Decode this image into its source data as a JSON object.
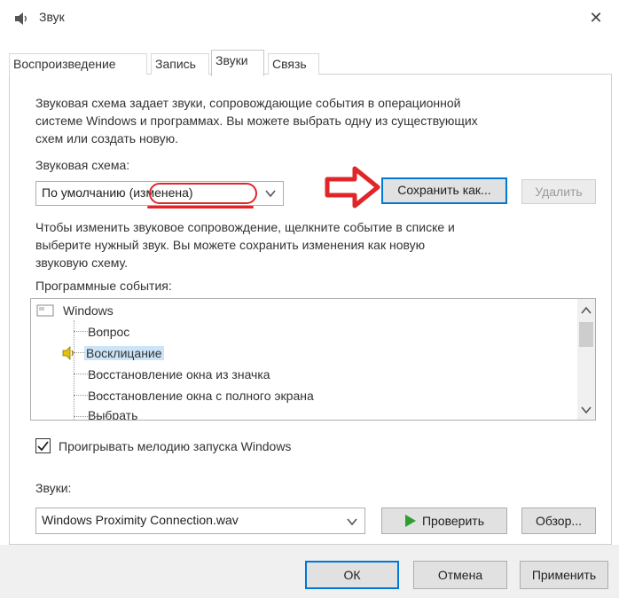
{
  "window": {
    "title": "Звук",
    "accent_color": "#0078d7",
    "highlight_color": "#e1262a"
  },
  "tabs": [
    {
      "label": "Воспроизведение",
      "active": false
    },
    {
      "label": "Запись",
      "active": false
    },
    {
      "label": "Звуки",
      "active": true
    },
    {
      "label": "Связь",
      "active": false
    }
  ],
  "sounds_tab": {
    "description_lines": [
      "Звуковая схема задает звуки, сопровождающие события в операционной",
      "системе Windows и программах. Вы можете выбрать одну из существующих",
      "схем или создать новую."
    ],
    "scheme_label": "Звуковая схема:",
    "scheme_value": "По умолчанию (изменена)",
    "save_as_label": "Сохранить как...",
    "delete_label": "Удалить",
    "instructions_lines": [
      "Чтобы изменить звуковое сопровождение, щелкните событие в списке и",
      "выберите нужный звук. Вы можете сохранить изменения как новую",
      "звуковую схему."
    ],
    "program_events_label": "Программные события:",
    "events": {
      "root": "Windows",
      "items": [
        {
          "label": "Вопрос",
          "has_sound": false,
          "selected": false
        },
        {
          "label": "Восклицание",
          "has_sound": true,
          "selected": true
        },
        {
          "label": "Восстановление окна из значка",
          "has_sound": false,
          "selected": false
        },
        {
          "label": "Восстановление окна с полного экрана",
          "has_sound": false,
          "selected": false
        },
        {
          "label": "Выбрать",
          "has_sound": false,
          "selected": false
        }
      ]
    },
    "startup_checkbox_label": "Проигрывать мелодию запуска Windows",
    "startup_checked": true,
    "sounds_label": "Звуки:",
    "sound_file_value": "Windows Proximity Connection.wav",
    "test_label": "Проверить",
    "browse_label": "Обзор..."
  },
  "footer": {
    "ok_label": "ОК",
    "cancel_label": "Отмена",
    "apply_label": "Применить"
  }
}
